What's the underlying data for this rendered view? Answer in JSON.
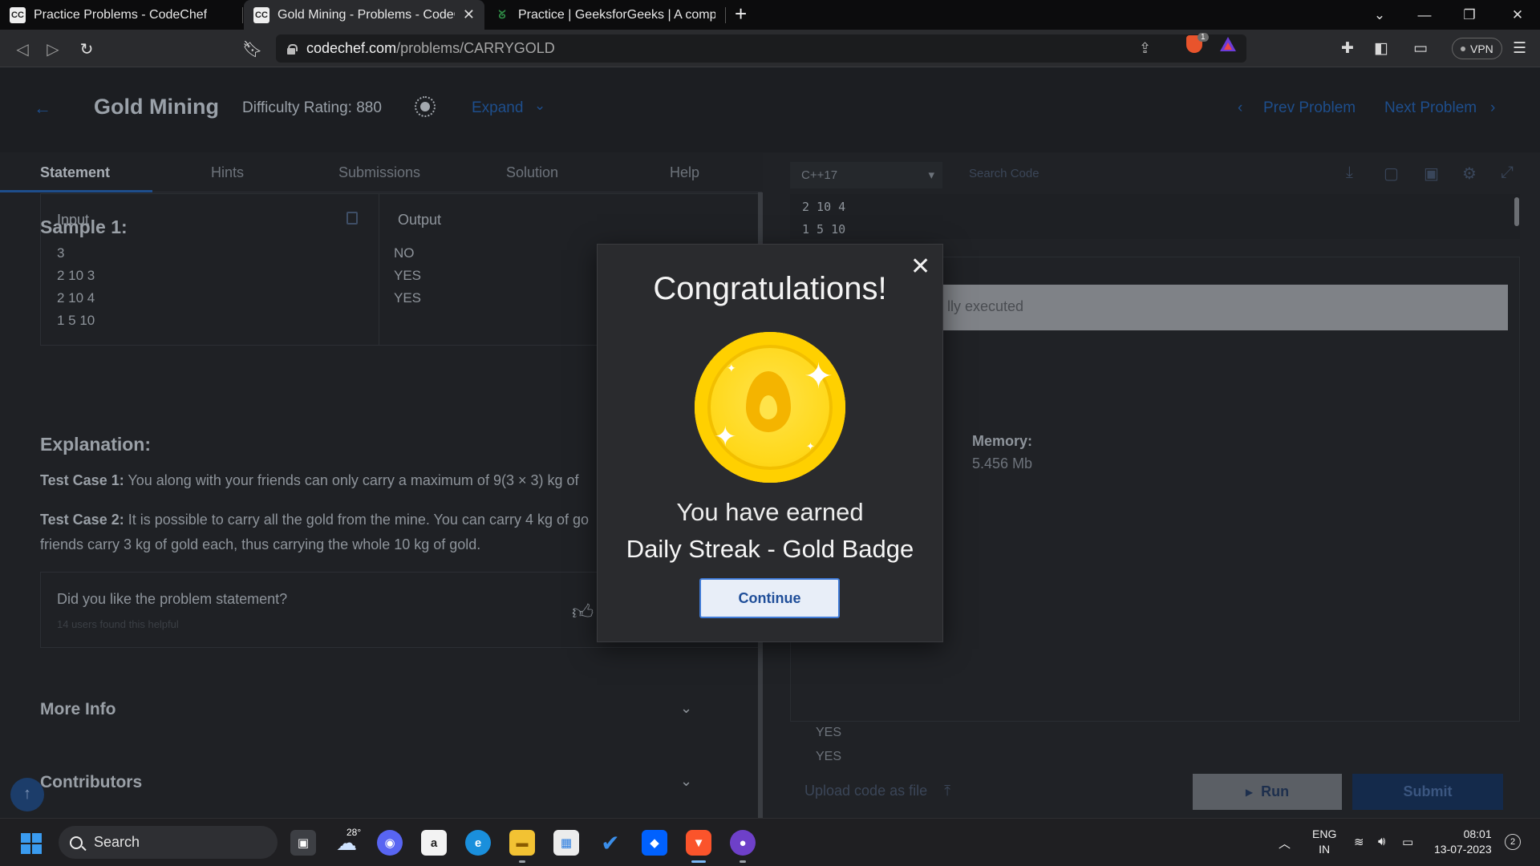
{
  "browser": {
    "tabs": [
      {
        "title": "Practice Problems - CodeChef",
        "favicon": "CC"
      },
      {
        "title": "Gold Mining - Problems - CodeCh",
        "favicon": "CC"
      },
      {
        "title": "Practice | GeeksforGeeks | A computer",
        "favicon": "GfG"
      }
    ],
    "url_host": "codechef.com",
    "url_path": "/problems/CARRYGOLD",
    "brave_count": "1",
    "vpn_label": "VPN"
  },
  "problem": {
    "title": "Gold Mining",
    "difficulty": "Difficulty Rating: 880",
    "expand_label": "Expand",
    "prev_label": "Prev Problem",
    "next_label": "Next Problem",
    "tabs": [
      "Statement",
      "Hints",
      "Submissions",
      "Solution",
      "Help"
    ],
    "sample_heading": "Sample 1:",
    "input_header": "Input",
    "output_header": "Output",
    "input_lines": [
      "3",
      "2 10 3",
      "2 10 4",
      "1 5 10"
    ],
    "output_lines": [
      "NO",
      "YES",
      "YES"
    ],
    "explanation_heading": "Explanation:",
    "tc1_label": "Test Case 1:",
    "tc1_text": " You along with your friends can only carry a maximum of 9(3 × 3) kg of",
    "tc2_label": "Test Case 2:",
    "tc2_text": " It is possible to carry all the gold from the mine. You can carry 4 kg of go",
    "tc2_text_line2": "friends carry 3 kg of gold each, thus carrying the whole 10 kg of gold.",
    "feedback_question": "Did you like the problem statement?",
    "feedback_sub": "14 users found this helpful",
    "more_info": "More Info",
    "contributors": "Contributors"
  },
  "editor": {
    "language": "C++17",
    "search_placeholder": "Search Code",
    "code_lines": [
      "2 10 4",
      "1 5 10"
    ],
    "status_text": "lly executed",
    "memory_label": "Memory:",
    "memory_value": "5.456 Mb",
    "output_lines": [
      "YES",
      "YES"
    ],
    "upload_label": "Upload code as file",
    "run_label": "Run",
    "submit_label": "Submit"
  },
  "modal": {
    "title": "Congratulations!",
    "earned_text": "You have earned",
    "badge_name": "Daily Streak - Gold Badge",
    "continue_label": "Continue"
  },
  "taskbar": {
    "search_label": "Search",
    "weather_temp": "28°",
    "lang_line1": "ENG",
    "lang_line2": "IN",
    "time": "08:01",
    "date": "13-07-2023",
    "notifications": "2"
  }
}
